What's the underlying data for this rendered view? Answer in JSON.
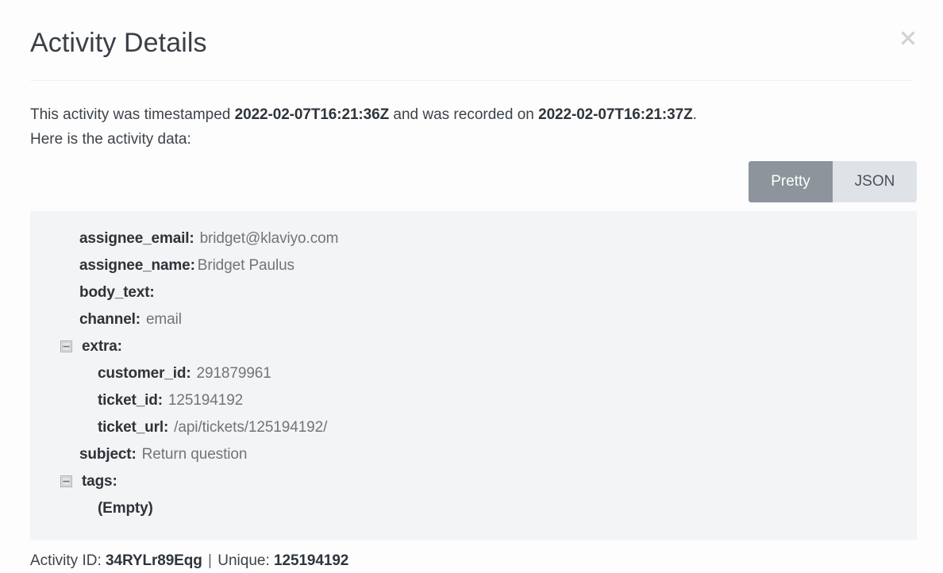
{
  "modal": {
    "title": "Activity Details",
    "close_icon": "close-icon"
  },
  "intro": {
    "prefix": "This activity was timestamped ",
    "timestamped_value": "2022-02-07T16:21:36Z",
    "middle": " and was recorded on ",
    "recorded_value": "2022-02-07T16:21:37Z",
    "period": ".",
    "second_line": "Here is the activity data:"
  },
  "view_toggle": {
    "pretty_label": "Pretty",
    "json_label": "JSON",
    "active": "Pretty",
    "active_bg": "#8d949b",
    "active_fg": "#ffffff",
    "inactive_bg": "#dfe3e7",
    "inactive_fg": "#4b5157"
  },
  "panel": {
    "background": "#f3f4f5",
    "rows": [
      {
        "key": "assignee_email:",
        "value": "bridget@klaviyo.com"
      },
      {
        "key": "assignee_name:",
        "value": "Bridget Paulus"
      },
      {
        "key": "body_text:",
        "value": ""
      },
      {
        "key": "channel:",
        "value": "email"
      },
      {
        "key": "extra:",
        "value": ""
      },
      {
        "key": "customer_id:",
        "value": "291879961"
      },
      {
        "key": "ticket_id:",
        "value": "125194192"
      },
      {
        "key": "ticket_url:",
        "value": "/api/tickets/125194192/"
      },
      {
        "key": "subject:",
        "value": "Return question"
      },
      {
        "key": "tags:",
        "value": ""
      },
      {
        "key": "(Empty)",
        "value": ""
      }
    ]
  },
  "footer": {
    "activity_id_label": "Activity ID:",
    "activity_id_value": "34RYLr89Eqg",
    "separator": "|",
    "unique_label": "Unique:",
    "unique_value": "125194192"
  }
}
